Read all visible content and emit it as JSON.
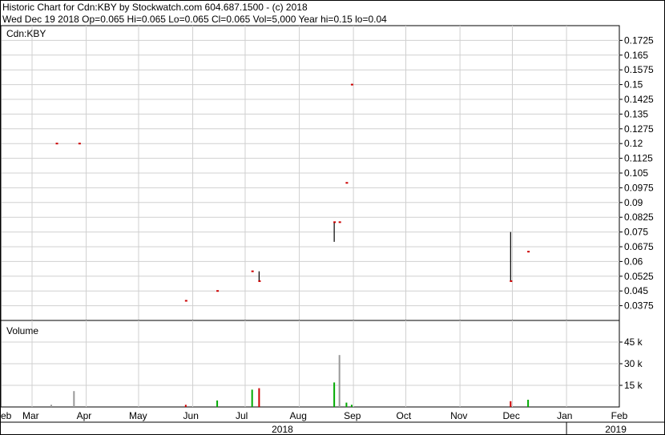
{
  "header": {
    "line1": "Historic Chart for Cdn:KBY by Stockwatch.com 604.687.1500 - (c) 2018",
    "line2": "Wed Dec 19 2018   Op=0.065  Hi=0.065  Lo=0.065  Cl=0.065  Vol=5,000  Year hi=0.15  lo=0.04"
  },
  "chart_data": [
    {
      "type": "ohlc",
      "panel_label": "Cdn:KBY",
      "y_ticks": [
        "0.1725",
        "0.165",
        "0.1575",
        "0.15",
        "0.1425",
        "0.135",
        "0.1275",
        "0.12",
        "0.1125",
        "0.105",
        "0.0975",
        "0.09",
        "0.0825",
        "0.075",
        "0.0675",
        "0.06",
        "0.0525",
        "0.045",
        "0.0375"
      ],
      "ylim": [
        0.03,
        0.18
      ],
      "grid": true,
      "bars": [
        {
          "date": "2018-03-15",
          "high": 0.12,
          "low": 0.12,
          "close": 0.12,
          "color": "#cc0000"
        },
        {
          "date": "2018-03-28",
          "high": 0.12,
          "low": 0.12,
          "close": 0.12,
          "color": "#cc0000"
        },
        {
          "date": "2018-05-28",
          "high": 0.04,
          "low": 0.04,
          "close": 0.04,
          "color": "#cc0000"
        },
        {
          "date": "2018-06-15",
          "high": 0.045,
          "low": 0.045,
          "close": 0.045,
          "color": "#cc0000"
        },
        {
          "date": "2018-07-05",
          "high": 0.055,
          "low": 0.055,
          "close": 0.055,
          "color": "#cc0000"
        },
        {
          "date": "2018-07-09",
          "high": 0.055,
          "low": 0.05,
          "close": 0.05,
          "color": "#cc0000"
        },
        {
          "date": "2018-08-21",
          "high": 0.08,
          "low": 0.07,
          "close": 0.08,
          "color": "#cc0000"
        },
        {
          "date": "2018-08-24",
          "high": 0.08,
          "low": 0.08,
          "close": 0.08,
          "color": "#cc0000"
        },
        {
          "date": "2018-08-28",
          "high": 0.1,
          "low": 0.1,
          "close": 0.1,
          "color": "#cc0000"
        },
        {
          "date": "2018-08-31",
          "high": 0.15,
          "low": 0.15,
          "close": 0.15,
          "color": "#cc0000"
        },
        {
          "date": "2018-11-30",
          "high": 0.075,
          "low": 0.05,
          "close": 0.05,
          "color": "#cc0000"
        },
        {
          "date": "2018-12-10",
          "high": 0.065,
          "low": 0.065,
          "close": 0.065,
          "color": "#cc0000"
        }
      ]
    },
    {
      "type": "bar",
      "panel_label": "Volume",
      "y_ticks": [
        "45 k",
        "30 k",
        "15 k"
      ],
      "ylim": [
        0,
        60000
      ],
      "grid": true,
      "bars": [
        {
          "date": "2018-03-12",
          "value": 1500,
          "color": "#999999"
        },
        {
          "date": "2018-03-25",
          "value": 11000,
          "color": "#999999"
        },
        {
          "date": "2018-05-28",
          "value": 1500,
          "color": "#cc0000"
        },
        {
          "date": "2018-06-15",
          "value": 4500,
          "color": "#00aa00"
        },
        {
          "date": "2018-07-05",
          "value": 12000,
          "color": "#00aa00"
        },
        {
          "date": "2018-07-09",
          "value": 13000,
          "color": "#cc0000"
        },
        {
          "date": "2018-08-21",
          "value": 17000,
          "color": "#00aa00"
        },
        {
          "date": "2018-08-24",
          "value": 36000,
          "color": "#999999"
        },
        {
          "date": "2018-08-28",
          "value": 3000,
          "color": "#00aa00"
        },
        {
          "date": "2018-08-31",
          "value": 1500,
          "color": "#00aa00"
        },
        {
          "date": "2018-11-30",
          "value": 4000,
          "color": "#cc0000"
        },
        {
          "date": "2018-12-10",
          "value": 5000,
          "color": "#00aa00"
        }
      ]
    }
  ],
  "x_axis": {
    "months": [
      {
        "label": "eb",
        "date": "2018-02-01"
      },
      {
        "label": "Mar",
        "date": "2018-03-01"
      },
      {
        "label": "Apr",
        "date": "2018-04-01"
      },
      {
        "label": "May",
        "date": "2018-05-01"
      },
      {
        "label": "Jun",
        "date": "2018-06-01"
      },
      {
        "label": "Jul",
        "date": "2018-07-01"
      },
      {
        "label": "Aug",
        "date": "2018-08-01"
      },
      {
        "label": "Sep",
        "date": "2018-09-01"
      },
      {
        "label": "Oct",
        "date": "2018-10-01"
      },
      {
        "label": "Nov",
        "date": "2018-11-01"
      },
      {
        "label": "Dec",
        "date": "2018-12-01"
      },
      {
        "label": "Jan",
        "date": "2019-01-01"
      },
      {
        "label": "Feb",
        "date": "2019-02-01"
      }
    ],
    "years": [
      {
        "label": "2018",
        "from": "2018-01-01",
        "to": "2018-12-31"
      },
      {
        "label": "2019",
        "from": "2019-01-01",
        "to": "2019-02-28"
      }
    ]
  }
}
